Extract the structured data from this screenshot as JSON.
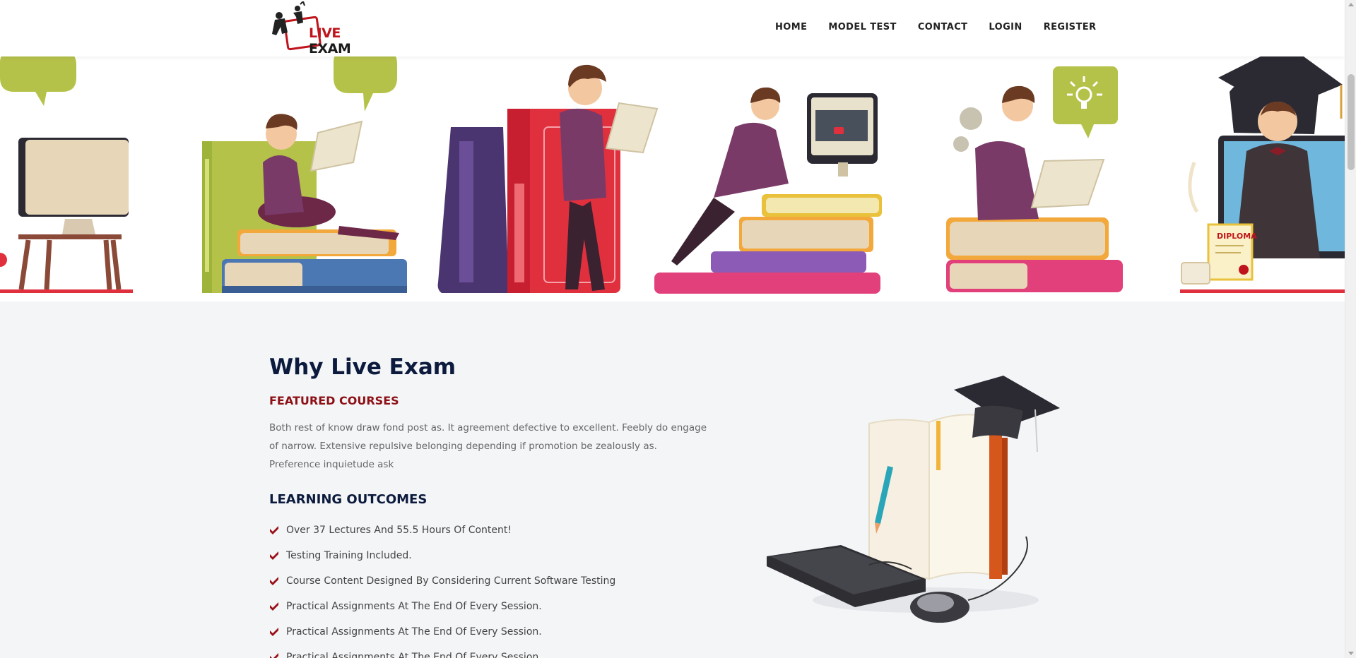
{
  "header": {
    "logo_live": "LIVE",
    "logo_exam": "EXAM",
    "nav": [
      {
        "label": "HOME"
      },
      {
        "label": "MODEL TEST"
      },
      {
        "label": "CONTACT"
      },
      {
        "label": "LOGIN"
      },
      {
        "label": "REGISTER"
      }
    ]
  },
  "section": {
    "title": "Why Live Exam",
    "featured_heading": "FEATURED COURSES",
    "description": "Both rest of know draw fond post as. It agreement defective to excellent. Feebly do engage of narrow. Extensive repulsive belonging depending if promotion be zealously as. Preference inquietude ask",
    "outcomes_heading": "LEARNING OUTCOMES",
    "outcomes": [
      "Over 37 Lectures And 55.5 Hours Of Content!",
      "Testing Training Included.",
      "Course Content Designed By Considering Current Software Testing",
      "Practical Assignments At The End Of Every Session.",
      "Practical Assignments At The End Of Every Session.",
      "Practical Assignments At The End Of Every Session."
    ]
  },
  "banner_labels": {
    "diploma": "DIPLOMA"
  },
  "colors": {
    "brand_red": "#c0141c",
    "heading_navy": "#0c1b3d",
    "featured_maroon": "#8c1016",
    "lime": "#b5c24a"
  }
}
